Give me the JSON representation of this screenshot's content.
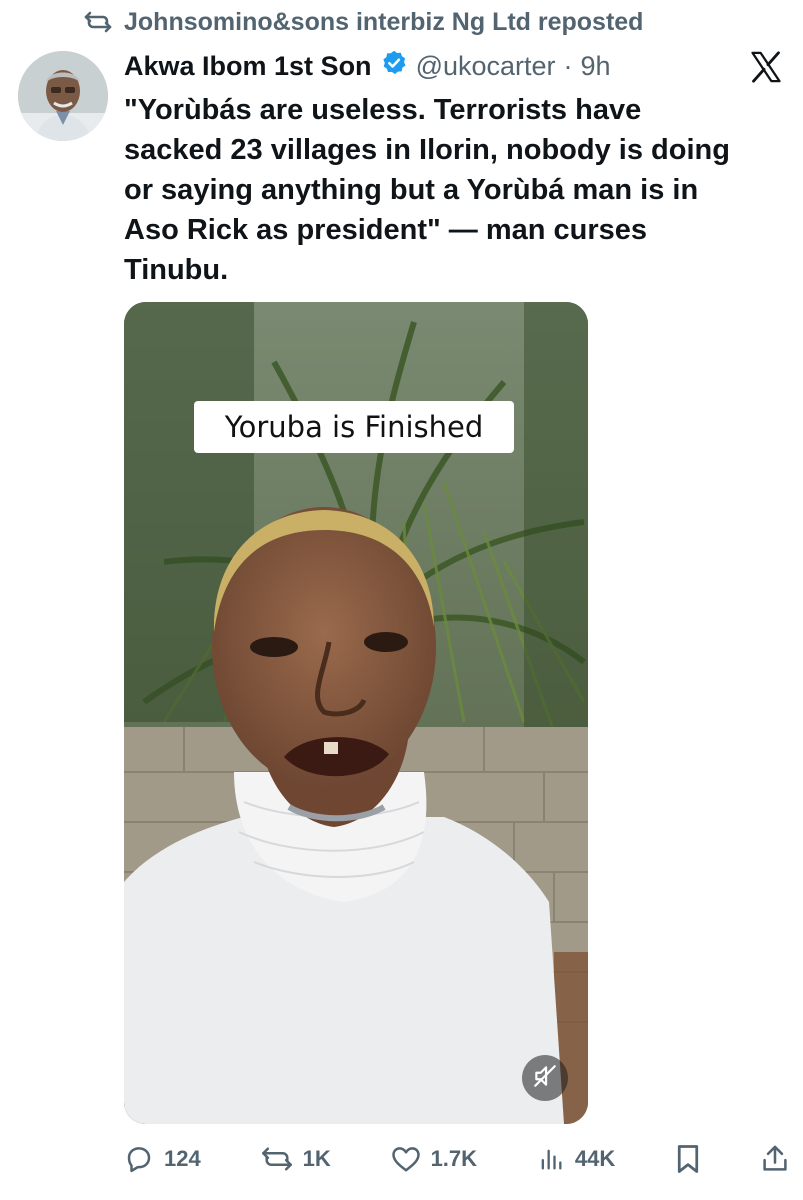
{
  "repost": {
    "text": "Johnsomino&sons interbiz Ng Ltd reposted",
    "icon": "repost-icon"
  },
  "author": {
    "name": "Akwa Ibom 1st Son",
    "verified_icon": "verified-badge-icon",
    "handle": "@ukocarter",
    "separator": "·",
    "time": "9h"
  },
  "platform_icon": "x-logo-icon",
  "tweet": {
    "text": "\"Yorùbás are useless. Terrorists have\nsacked 23 villages in Ilorin, nobody is doing\nor saying anything but a Yorùbá man is in\nAso Rick as president\" — man curses\nTinubu."
  },
  "media": {
    "caption": "Yoruba is Finished",
    "mute_icon": "muted-speaker-icon"
  },
  "actions": {
    "replies": "124",
    "reposts": "1K",
    "likes": "1.7K",
    "views": "44K",
    "bookmark_icon": "bookmark-icon",
    "share_icon": "share-icon"
  },
  "colors": {
    "text_primary": "#0f1419",
    "text_secondary": "#536471",
    "verified_blue": "#1d9bf0",
    "background": "#ffffff"
  }
}
